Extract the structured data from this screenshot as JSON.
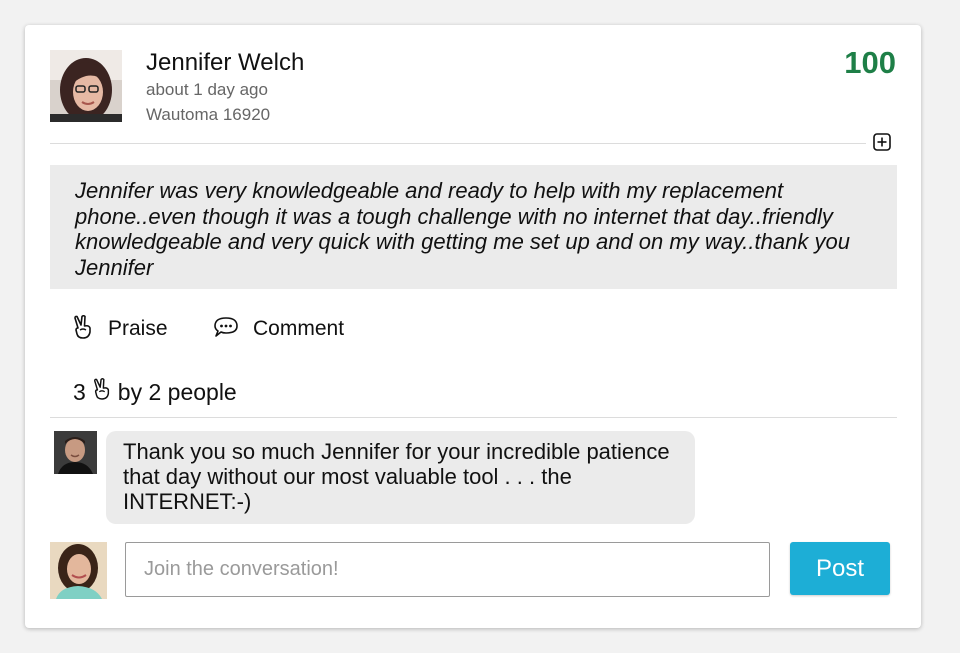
{
  "post": {
    "author_name": "Jennifer Welch",
    "time_ago": "about 1 day ago",
    "location": "Wautoma 16920",
    "score": "100",
    "message": "Jennifer was very knowledgeable and ready to help with my replacement phone..even though it was a tough challenge with no internet that day..friendly knowledgeable and very quick with getting me set up and on my way..thank you Jennifer",
    "expand_icon": "plus-square-icon"
  },
  "actions": {
    "praise_label": "Praise",
    "praise_icon": "peace-hand-icon",
    "comment_label": "Comment",
    "comment_icon": "speech-bubble-icon"
  },
  "praise_summary": {
    "count": "3",
    "by_text": "by 2 people"
  },
  "comments": [
    {
      "text": "Thank you so much Jennifer for your incredible patience that day without our most valuable tool . . . the INTERNET:-)"
    }
  ],
  "reply": {
    "placeholder": "Join the conversation!",
    "value": "",
    "post_label": "Post"
  },
  "colors": {
    "score": "#1e7f47",
    "post_button": "#1daed6",
    "message_bg": "#ebebeb"
  }
}
